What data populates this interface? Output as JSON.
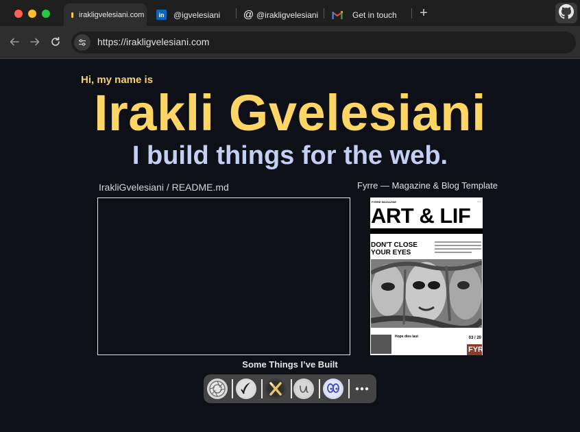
{
  "browser": {
    "tabs": [
      {
        "label": "irakligvelesiani.com",
        "active": true
      },
      {
        "label": "@igvelesiani",
        "active": false
      },
      {
        "label": "@irakligvelesiani",
        "active": false
      },
      {
        "label": "Get in touch",
        "active": false
      }
    ],
    "url": "https://irakligvelesiani.com"
  },
  "hero": {
    "greeting": "Hi, my name is",
    "name": "Irakli Gvelesiani",
    "tagline": "I build things for the web."
  },
  "readme": {
    "label": "IrakliGvelesiani / README.md"
  },
  "project_preview": {
    "label": "Fyrre — Magazine & Blog Template",
    "brand": "FYRRE MAGAZINE",
    "title": "ART & LIF",
    "headline": "DON'T CLOSE YOUR EYES",
    "subheadline": "Hope dies last",
    "date": "03 / 20",
    "logo": "FYR"
  },
  "projects": {
    "heading": "Some Things I’ve Built",
    "dock_icons": [
      "aperture-icon",
      "quill-icon",
      "cutlery-icon",
      "script-u-icon",
      "eyes-icon",
      "more-icon"
    ]
  },
  "colors": {
    "accent_yellow": "#ffd666",
    "tagline_blue": "#c3cff4",
    "background": "#0d1117"
  }
}
